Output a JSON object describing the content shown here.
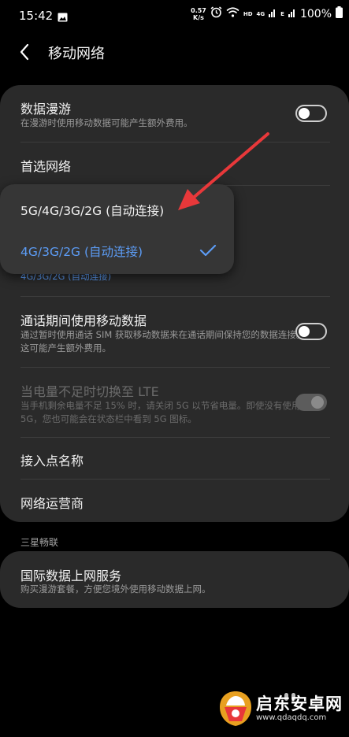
{
  "status_bar": {
    "time": "15:42",
    "speed_value": "0.57",
    "speed_unit": "K/s",
    "hd": "HD",
    "network_4g": "4G",
    "network_e": "E",
    "battery": "100%"
  },
  "header": {
    "title": "移动网络"
  },
  "settings": {
    "roaming": {
      "label": "数据漫游",
      "desc": "在漫游时使用移动数据可能产生额外费用。",
      "enabled": false
    },
    "preferred_network": {
      "label": "首选网络",
      "value": "4G/3G/2G (自动连接)"
    },
    "call_data": {
      "label": "通话期间使用移动数据",
      "desc": "通过暂时使用通话 SIM 获取移动数据来在通话期间保持您的数据连接。 这可能产生额外费用。",
      "enabled": false
    },
    "lte_switch": {
      "label": "当电量不足时切换至 LTE",
      "desc": "当手机剩余电量不足 15% 时，请关闭 5G 以节省电量。即使没有使用 5G，您也可能会在状态栏中看到 5G 图标。",
      "enabled": true,
      "disabled": true
    },
    "apn": {
      "label": "接入点名称"
    },
    "operators": {
      "label": "网络运营商"
    }
  },
  "section": {
    "label": "三星畅联"
  },
  "intl_data": {
    "label": "国际数据上网服务",
    "desc": "购买漫游套餐，方便您境外使用移动数据上网。"
  },
  "popup": {
    "options": [
      {
        "label": "5G/4G/3G/2G (自动连接)",
        "selected": false
      },
      {
        "label": "4G/3G/2G (自动连接)",
        "selected": true
      }
    ]
  },
  "watermark": {
    "name": "启东安卓网",
    "url": "www.qdaqdq.com"
  },
  "colors": {
    "accent": "#5c9cf5",
    "annotation_arrow": "#e8383a",
    "card": "#2a2a2a",
    "popup": "#363636"
  }
}
